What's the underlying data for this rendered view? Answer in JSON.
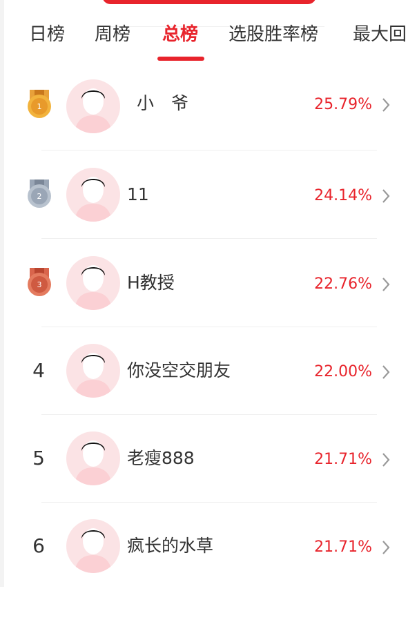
{
  "tabs": [
    {
      "label": "日榜"
    },
    {
      "label": "周榜"
    },
    {
      "label": "总榜"
    },
    {
      "label": "选股胜率榜"
    },
    {
      "label": "最大回"
    }
  ],
  "rows": [
    {
      "rank": "1",
      "name": "小　爷",
      "pct": "25.79%",
      "medal": "gold"
    },
    {
      "rank": "2",
      "name": "11",
      "pct": "24.14%",
      "medal": "silver"
    },
    {
      "rank": "3",
      "name": "H教授",
      "pct": "22.76%",
      "medal": "bronze"
    },
    {
      "rank": "4",
      "name": "你没空交朋友",
      "pct": "22.00%"
    },
    {
      "rank": "5",
      "name": "老瘦888",
      "pct": "21.71%"
    },
    {
      "rank": "6",
      "name": "疯长的水草",
      "pct": "21.71%"
    }
  ],
  "colors": {
    "accent": "#e8242c",
    "gold": "#f0a23a",
    "silver": "#aab4c2",
    "bronze": "#d9654c"
  }
}
